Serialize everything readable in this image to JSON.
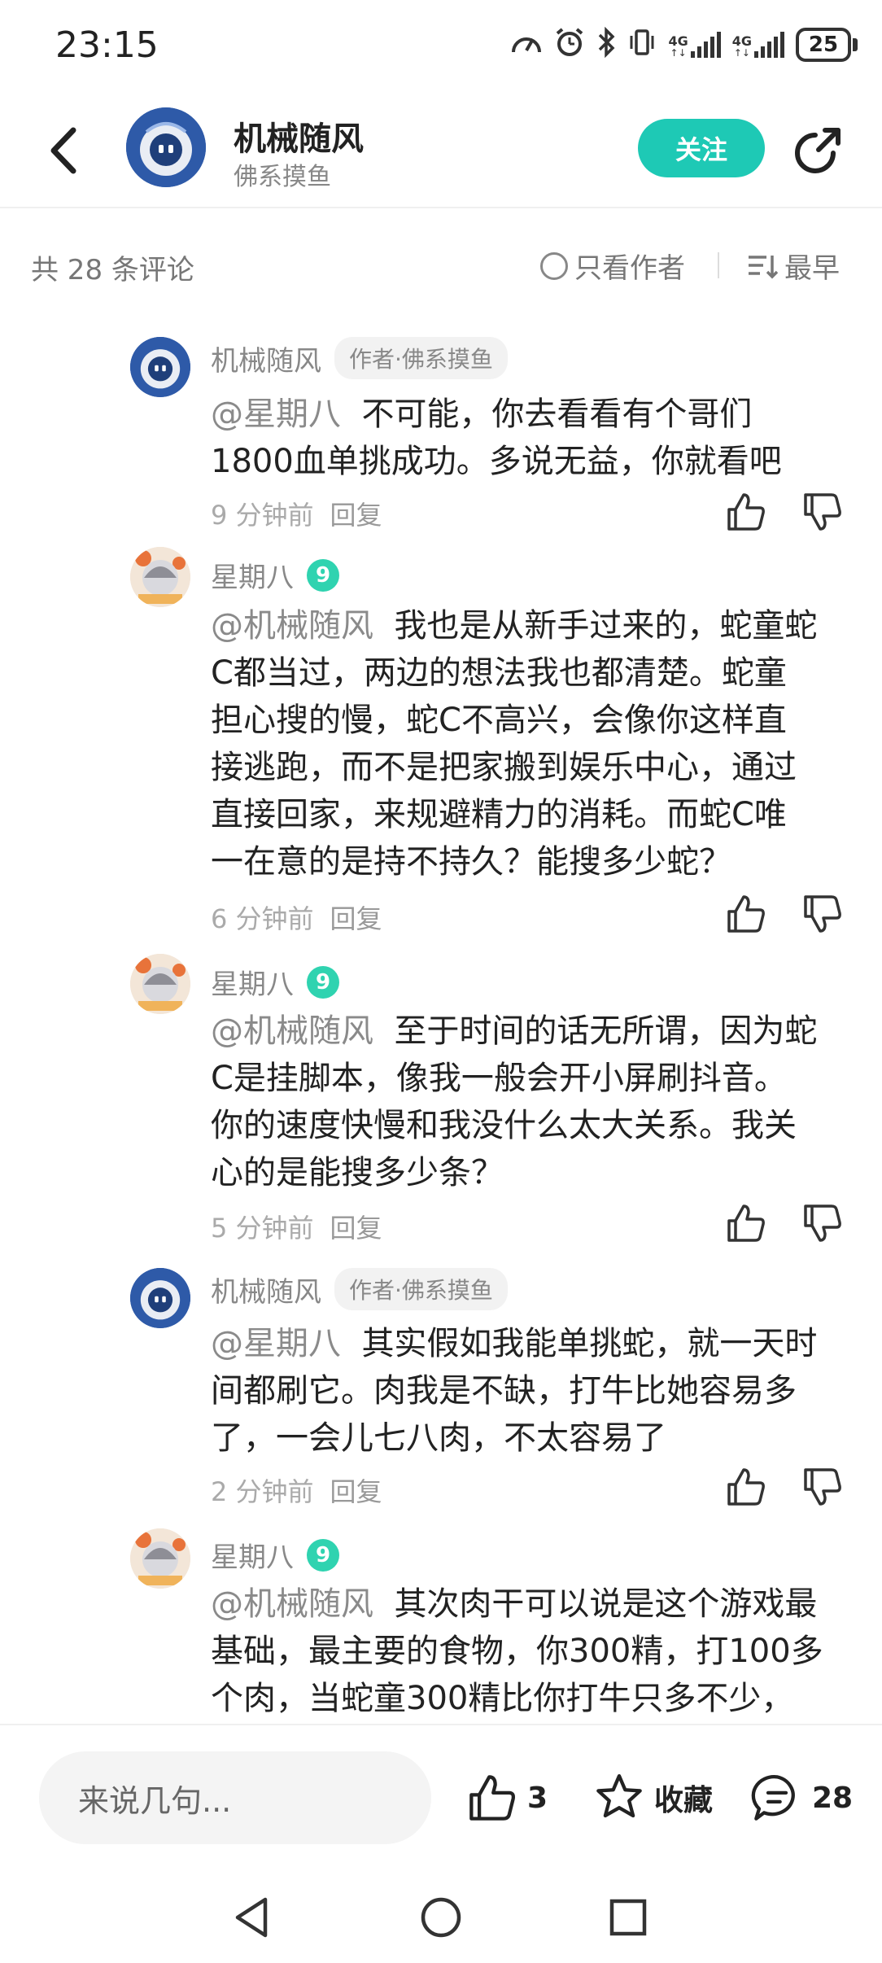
{
  "status_bar": {
    "time": "23:15",
    "net_label_1": "4G",
    "net_label_2": "4G",
    "battery": "25"
  },
  "header": {
    "name": "机械随风",
    "subtitle": "佛系摸鱼",
    "follow_label": "关注"
  },
  "comments_bar": {
    "count_text": "共 28 条评论",
    "only_author_label": "只看作者",
    "sort_label": "最早"
  },
  "comments": [
    {
      "name": "机械随风",
      "badge": "作者·佛系摸鱼",
      "mention": "@星期八",
      "lines": [
        "不可能，你去看看有个哥们",
        "1800血单挑成功。多说无益，你就看吧"
      ],
      "time": "9 分钟前",
      "reply": "回复"
    },
    {
      "name": "星期八",
      "level": "9",
      "mention": "@机械随风",
      "lines": [
        "我也是从新手过来的，蛇童蛇",
        "C都当过，两边的想法我也都清楚。蛇童",
        "担心搜的慢，蛇C不高兴，会像你这样直",
        "接逃跑，而不是把家搬到娱乐中心，通过",
        "直接回家，来规避精力的消耗。而蛇C唯",
        "一在意的是持不持久？能搜多少蛇？"
      ],
      "time": "6 分钟前",
      "reply": "回复"
    },
    {
      "name": "星期八",
      "level": "9",
      "mention": "@机械随风",
      "lines": [
        "至于时间的话无所谓，因为蛇",
        "C是挂脚本，像我一般会开小屏刷抖音。",
        "你的速度快慢和我没什么太大关系。我关",
        "心的是能搜多少条？"
      ],
      "time": "5 分钟前",
      "reply": "回复"
    },
    {
      "name": "机械随风",
      "badge": "作者·佛系摸鱼",
      "mention": "@星期八",
      "lines": [
        "其实假如我能单挑蛇，就一天时",
        "间都刷它。肉我是不缺，打牛比她容易多",
        "了，一会儿七八肉，不太容易了"
      ],
      "time": "2 分钟前",
      "reply": "回复"
    },
    {
      "name": "星期八",
      "level": "9",
      "mention": "@机械随风",
      "lines": [
        "其次肉干可以说是这个游戏最",
        "基础，最主要的食物，你300精，打100多",
        "个肉，当蛇童300精比你打牛只多不少，"
      ]
    }
  ],
  "bottom_bar": {
    "input_placeholder": "来说几句...",
    "like_count": "3",
    "favorite_label": "收藏",
    "comment_count": "28"
  }
}
